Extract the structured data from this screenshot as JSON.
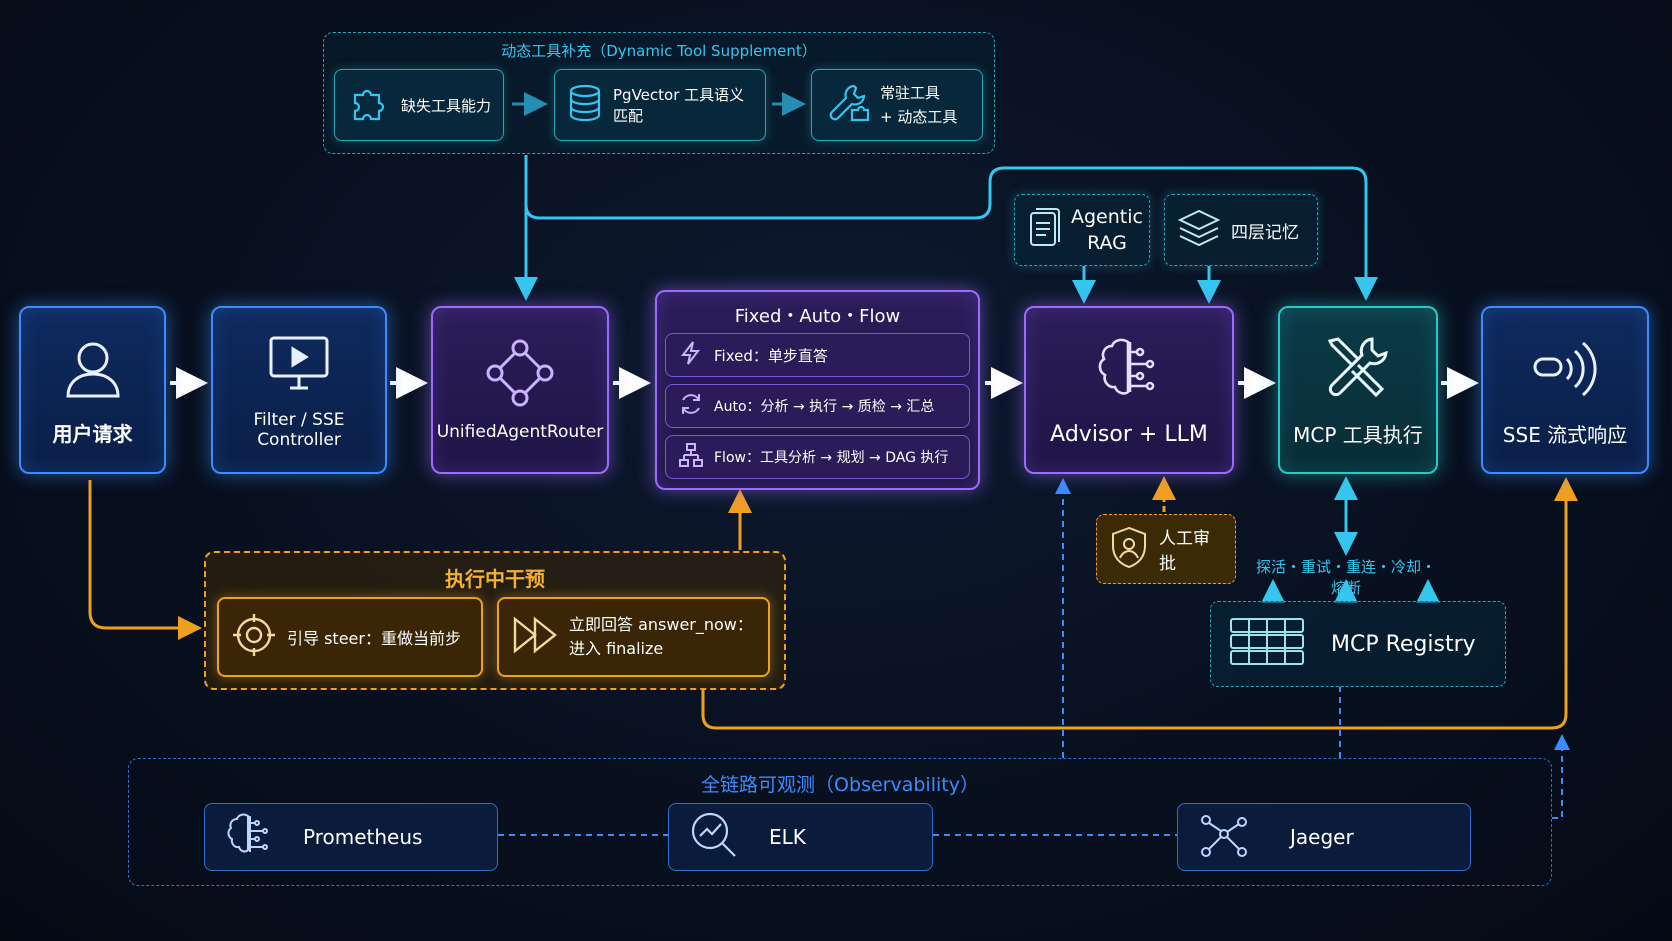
{
  "dynamic_tool": {
    "title": "动态工具补充（Dynamic Tool Supplement）",
    "step1": "缺失工具能力",
    "step2": "PgVector 工具语义匹配",
    "step3_line1": "常驻工具",
    "step3_line2": "+ 动态工具"
  },
  "main_flow": {
    "user": "用户请求",
    "filter": "Filter / SSE Controller",
    "router": "UnifiedAgentRouter",
    "modes_title": "Fixed・Auto・Flow",
    "mode_fixed": "Fixed：单步直答",
    "mode_auto": "Auto：分析 → 执行 → 质检 → 汇总",
    "mode_flow": "Flow：工具分析 → 规划 → DAG 执行",
    "advisor": "Advisor + LLM",
    "mcp_exec": "MCP 工具执行",
    "sse": "SSE 流式响应"
  },
  "advisor_inputs": {
    "rag_line1": "Agentic",
    "rag_line2": "RAG",
    "memory": "四层记忆"
  },
  "approval": "人工审批",
  "intervention": {
    "title": "执行中干预",
    "steer": "引导 steer：重做当前步",
    "answer_line1": "立即回答 answer_now：",
    "answer_line2": "进入 finalize"
  },
  "registry": {
    "features": "探活・重试・重连・冷却・熔断",
    "name": "MCP Registry"
  },
  "observability": {
    "title": "全链路可观测（Observability）",
    "prometheus": "Prometheus",
    "elk": "ELK",
    "jaeger": "Jaeger"
  },
  "colors": {
    "blue": "#3a8cff",
    "purple": "#9a6cff",
    "teal": "#27c9c9",
    "orange": "#f0a020",
    "cyan_line": "#35c6f0"
  },
  "icons": [
    "user-icon",
    "monitor-play-icon",
    "network-icon",
    "lightning-icon",
    "refresh-icon",
    "flowchart-icon",
    "brain-icon",
    "tools-icon",
    "signal-icon",
    "puzzle-icon",
    "database-icon",
    "wrench-puzzle-icon",
    "document-icon",
    "layers-icon",
    "shield-user-icon",
    "target-icon",
    "fast-forward-icon",
    "server-icon",
    "brain-icon",
    "search-chart-icon",
    "graph-icon"
  ]
}
